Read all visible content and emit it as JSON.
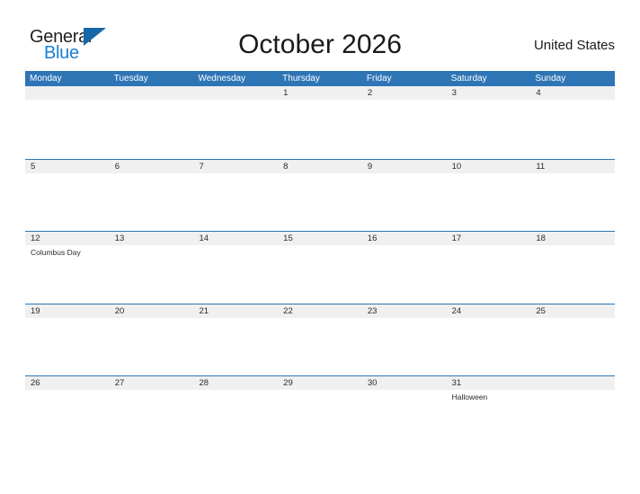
{
  "brand": {
    "name_part1": "General",
    "name_part2": "Blue",
    "flag_icon": "blue-triangle-flag"
  },
  "header": {
    "title": "October 2026",
    "country": "United States"
  },
  "calendar": {
    "weekdays": [
      "Monday",
      "Tuesday",
      "Wednesday",
      "Thursday",
      "Friday",
      "Saturday",
      "Sunday"
    ],
    "colors": {
      "header_blue": "#2e75b6",
      "band_gray": "#f0f0f0",
      "brand_blue": "#1a7fd4",
      "text": "#2b2b2b"
    },
    "weeks": [
      [
        {
          "day": "",
          "events": []
        },
        {
          "day": "",
          "events": []
        },
        {
          "day": "",
          "events": []
        },
        {
          "day": "1",
          "events": []
        },
        {
          "day": "2",
          "events": []
        },
        {
          "day": "3",
          "events": []
        },
        {
          "day": "4",
          "events": []
        }
      ],
      [
        {
          "day": "5",
          "events": []
        },
        {
          "day": "6",
          "events": []
        },
        {
          "day": "7",
          "events": []
        },
        {
          "day": "8",
          "events": []
        },
        {
          "day": "9",
          "events": []
        },
        {
          "day": "10",
          "events": []
        },
        {
          "day": "11",
          "events": []
        }
      ],
      [
        {
          "day": "12",
          "events": [
            "Columbus Day"
          ]
        },
        {
          "day": "13",
          "events": []
        },
        {
          "day": "14",
          "events": []
        },
        {
          "day": "15",
          "events": []
        },
        {
          "day": "16",
          "events": []
        },
        {
          "day": "17",
          "events": []
        },
        {
          "day": "18",
          "events": []
        }
      ],
      [
        {
          "day": "19",
          "events": []
        },
        {
          "day": "20",
          "events": []
        },
        {
          "day": "21",
          "events": []
        },
        {
          "day": "22",
          "events": []
        },
        {
          "day": "23",
          "events": []
        },
        {
          "day": "24",
          "events": []
        },
        {
          "day": "25",
          "events": []
        }
      ],
      [
        {
          "day": "26",
          "events": []
        },
        {
          "day": "27",
          "events": []
        },
        {
          "day": "28",
          "events": []
        },
        {
          "day": "29",
          "events": []
        },
        {
          "day": "30",
          "events": []
        },
        {
          "day": "31",
          "events": [
            "Halloween"
          ]
        },
        {
          "day": "",
          "events": []
        }
      ]
    ]
  }
}
